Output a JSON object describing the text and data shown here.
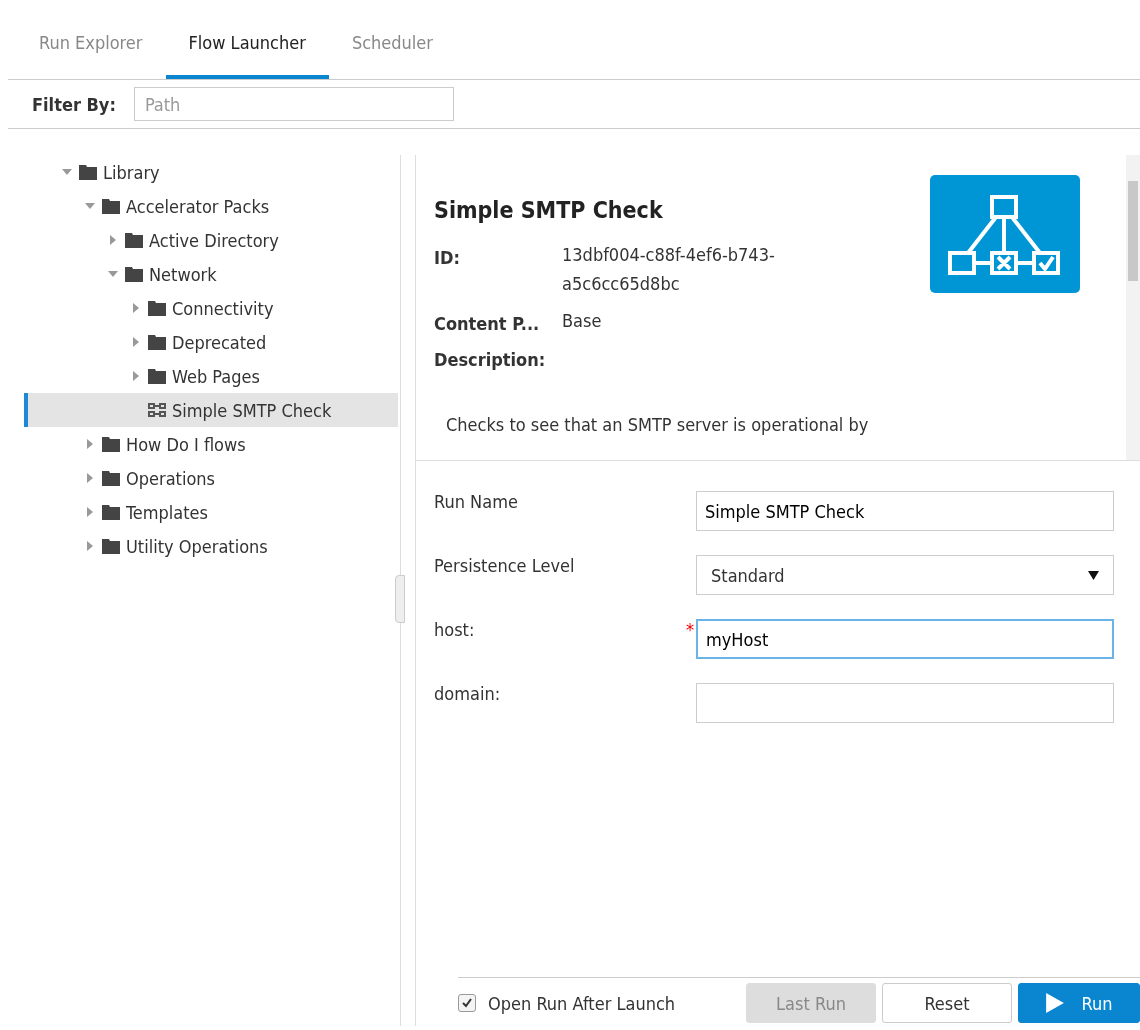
{
  "tabs": [
    {
      "label": "Run Explorer",
      "selected": false
    },
    {
      "label": "Flow Launcher",
      "selected": true
    },
    {
      "label": "Scheduler",
      "selected": false
    }
  ],
  "filter": {
    "label": "Filter By:",
    "placeholder": "Path"
  },
  "tree": [
    {
      "label": "Library",
      "kind": "folder",
      "expanded": true,
      "selected": false,
      "children": [
        {
          "label": "Accelerator Packs",
          "kind": "folder",
          "expanded": true,
          "selected": false,
          "children": [
            {
              "label": "Active Directory",
              "kind": "folder",
              "expanded": false,
              "selected": false
            },
            {
              "label": "Network",
              "kind": "folder",
              "expanded": true,
              "selected": false,
              "children": [
                {
                  "label": "Connectivity",
                  "kind": "folder",
                  "expanded": false,
                  "selected": false
                },
                {
                  "label": "Deprecated",
                  "kind": "folder",
                  "expanded": false,
                  "selected": false
                },
                {
                  "label": "Web Pages",
                  "kind": "folder",
                  "expanded": false,
                  "selected": false
                },
                {
                  "label": "Simple SMTP Check",
                  "kind": "flow",
                  "selected": true
                }
              ]
            }
          ]
        },
        {
          "label": "How Do I flows",
          "kind": "folder",
          "expanded": false,
          "selected": false
        },
        {
          "label": "Operations",
          "kind": "folder",
          "expanded": false,
          "selected": false
        },
        {
          "label": "Templates",
          "kind": "folder",
          "expanded": false,
          "selected": false
        },
        {
          "label": "Utility Operations",
          "kind": "folder",
          "expanded": false,
          "selected": false
        }
      ]
    }
  ],
  "details": {
    "title": "Simple SMTP Check",
    "properties": [
      {
        "label": "ID:",
        "value": "13dbf004-c88f-4ef6-b743-a5c6cc65d8bc"
      },
      {
        "label": "Content P...",
        "value": "Base"
      },
      {
        "label": "Description:"
      }
    ],
    "description": "Checks to see that an SMTP server is operational by"
  },
  "form": [
    {
      "label": "Run Name",
      "kind": "text",
      "value": "Simple SMTP Check",
      "focused": false
    },
    {
      "label": "Persistence Level",
      "kind": "select",
      "value": "Standard",
      "focused": false
    },
    {
      "label": "host:",
      "kind": "text",
      "value": "myHost",
      "required_mark": "*",
      "focused": true
    },
    {
      "label": "domain:",
      "kind": "text",
      "focused": false
    }
  ],
  "open_after_launch": {
    "label": "Open Run After Launch",
    "checked": true
  },
  "buttons": [
    {
      "label": "Last Run",
      "kind": "secondary",
      "disabled": true
    },
    {
      "label": "Reset",
      "kind": "secondary",
      "disabled": false
    },
    {
      "label": "Run",
      "kind": "primary",
      "disabled": false
    }
  ]
}
